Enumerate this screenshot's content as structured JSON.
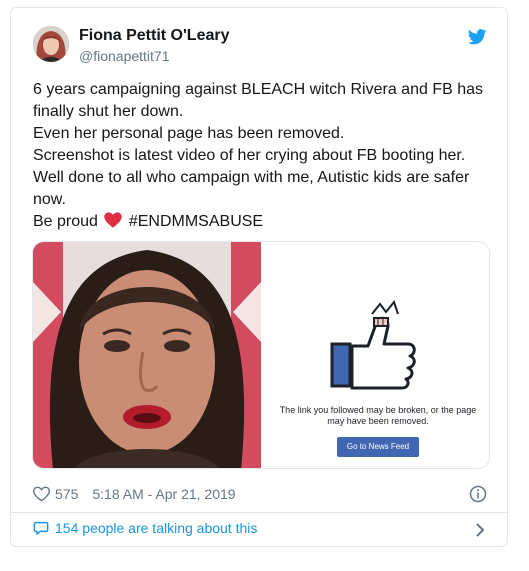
{
  "author": {
    "display_name": "Fiona Pettit O'Leary",
    "handle": "@fionapettit71",
    "avatar_icon": "avatar-photo"
  },
  "tweet": {
    "lines": [
      "6 years campaigning against BLEACH witch Rivera and FB has finally shut her down.",
      "Even her personal page has been removed.",
      "Screenshot is latest video of her crying about FB booting her.",
      "Well done to all who campaign with me, Autistic kids are safer now."
    ],
    "last_line_prefix": "Be proud",
    "hashtag": "#ENDMMSABUSE",
    "emoji": "red-heart"
  },
  "media": {
    "broken_link_text": "The link you followed may be broken, or the page may have been removed.",
    "news_feed_button": "Go to News Feed"
  },
  "meta": {
    "like_count": "575",
    "timestamp": "5:18 AM - Apr 21, 2019"
  },
  "footer": {
    "talking_text": "154 people are talking about this"
  },
  "colors": {
    "twitter_blue": "#1da1f2",
    "link_blue": "#1b95e0",
    "facebook_blue": "#4267b2",
    "heart_red": "#e0245e"
  }
}
